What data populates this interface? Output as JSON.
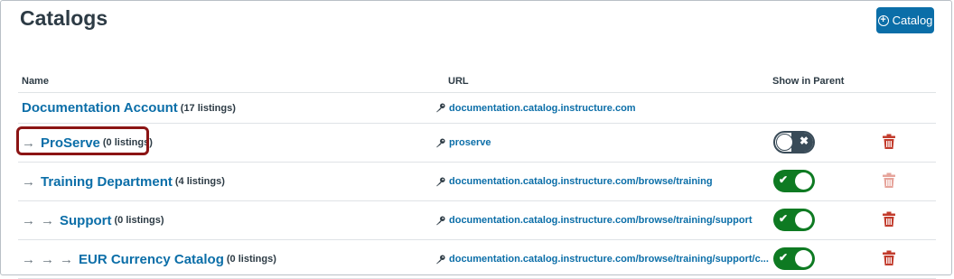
{
  "header": {
    "title": "Catalogs",
    "add_button_label": "Catalog"
  },
  "columns": {
    "name": "Name",
    "url": "URL",
    "show": "Show in Parent"
  },
  "rows": [
    {
      "depth": 0,
      "name": "Documentation Account",
      "count": "(17 listings)",
      "url": "documentation.catalog.instructure.com",
      "toggle": null,
      "delete": null
    },
    {
      "depth": 1,
      "name": "ProServe",
      "count": "(0 listings)",
      "url": "proserve",
      "toggle": "off",
      "delete": "enabled"
    },
    {
      "depth": 1,
      "name": "Training Department",
      "count": "(4 listings)",
      "url": "documentation.catalog.instructure.com/browse/training",
      "toggle": "on",
      "delete": "disabled"
    },
    {
      "depth": 2,
      "name": "Support",
      "count": "(0 listings)",
      "url": "documentation.catalog.instructure.com/browse/training/support",
      "toggle": "on",
      "delete": "enabled"
    },
    {
      "depth": 3,
      "name": "EUR Currency Catalog",
      "count": "(0 listings)",
      "url": "documentation.catalog.instructure.com/browse/training/support/c...",
      "toggle": "on",
      "delete": "enabled"
    }
  ],
  "glyphs": {
    "arrow": "→",
    "check": "✔",
    "cross": "✖",
    "plus": "+"
  },
  "colors": {
    "link": "#0b6ea8",
    "toggle_on": "#0e7a22",
    "delete": "#c23c2d",
    "delete_disabled": "#e6a49b",
    "highlight": "#8b1414"
  },
  "icons": {
    "url": "key-icon",
    "delete": "trash-icon",
    "add": "plus-circle-icon"
  }
}
